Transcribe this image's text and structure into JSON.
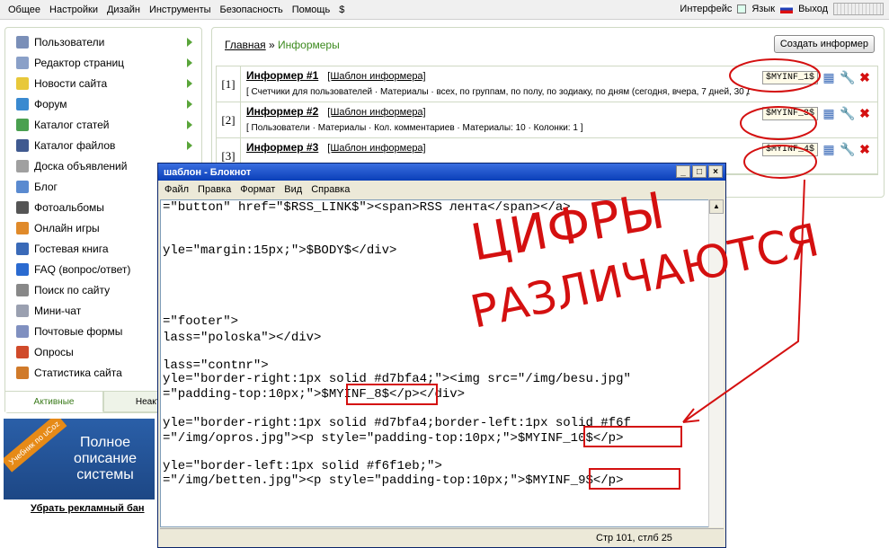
{
  "topbar": {
    "menu": [
      "Общее",
      "Настройки",
      "Дизайн",
      "Инструменты",
      "Безопасность",
      "Помощь",
      "$"
    ],
    "interface_label": "Интерфейс",
    "language_label": "Язык",
    "logout_label": "Выход"
  },
  "sidebar": {
    "items": [
      {
        "label": "Пользователи",
        "icon": "users-icon",
        "color": "#7a8fb8",
        "arrow": true
      },
      {
        "label": "Редактор страниц",
        "icon": "page-editor-icon",
        "color": "#8aa0c8",
        "arrow": true
      },
      {
        "label": "Новости сайта",
        "icon": "bulb-icon",
        "color": "#e8c83a",
        "arrow": true
      },
      {
        "label": "Форум",
        "icon": "forum-icon",
        "color": "#3a8ad0",
        "arrow": true
      },
      {
        "label": "Каталог статей",
        "icon": "articles-icon",
        "color": "#4aa050",
        "arrow": true
      },
      {
        "label": "Каталог файлов",
        "icon": "files-icon",
        "color": "#405a90",
        "arrow": true
      },
      {
        "label": "Доска объявлений",
        "icon": "board-icon",
        "color": "#a0a0a0",
        "arrow": false
      },
      {
        "label": "Блог",
        "icon": "blog-icon",
        "color": "#5a8ad0",
        "arrow": false
      },
      {
        "label": "Фотоальбомы",
        "icon": "camera-icon",
        "color": "#555555",
        "arrow": false
      },
      {
        "label": "Онлайн игры",
        "icon": "games-icon",
        "color": "#e08a2a",
        "arrow": false
      },
      {
        "label": "Гостевая книга",
        "icon": "guestbook-icon",
        "color": "#3a6ab8",
        "arrow": false
      },
      {
        "label": "FAQ (вопрос/ответ)",
        "icon": "faq-icon",
        "color": "#2a6ad0",
        "arrow": false
      },
      {
        "label": "Поиск по сайту",
        "icon": "search-icon",
        "color": "#888888",
        "arrow": false
      },
      {
        "label": "Мини-чат",
        "icon": "chat-icon",
        "color": "#9aa0b0",
        "arrow": false
      },
      {
        "label": "Почтовые формы",
        "icon": "mail-icon",
        "color": "#8090c0",
        "arrow": false
      },
      {
        "label": "Опросы",
        "icon": "poll-icon",
        "color": "#d04a2a",
        "arrow": false
      },
      {
        "label": "Статистика сайта",
        "icon": "stats-icon",
        "color": "#d07a2a",
        "arrow": false
      }
    ],
    "tab_active": "Активные",
    "tab_inactive": "Неактив"
  },
  "banner": {
    "ribbon": "Учебник по uCoz",
    "line1": "Полное",
    "line2": "описание",
    "line3": "системы",
    "ad_link": "Убрать рекламный бан"
  },
  "main": {
    "crumb_home": "Главная",
    "crumb_sep": " » ",
    "crumb_current": "Информеры",
    "create_button": "Создать информер",
    "rows": [
      {
        "num": "[1]",
        "title": "Информер #1",
        "template": "[Шаблон информера]",
        "code": "$MYINF_1$",
        "desc": "[ Счетчики для пользователей · Материалы · всех, по группам, по полу, по зодиаку, по дням (сегодня, вчера, 7 дней, 30 дней) ]"
      },
      {
        "num": "[2]",
        "title": "Информер #2",
        "template": "[Шаблон информера]",
        "code": "$MYINF_3$",
        "desc": "[ Пользователи · Материалы · Кол. комментариев · Материалы: 10 · Колонки: 1 ]"
      },
      {
        "num": "[3]",
        "title": "Информер #3",
        "template": "[Шаблон информера]",
        "code": "$MYINF_4$",
        "desc": ""
      }
    ]
  },
  "notepad": {
    "title": "шаблон - Блокнот",
    "menu": [
      "Файл",
      "Правка",
      "Формат",
      "Вид",
      "Справка"
    ],
    "lines": [
      "=\"button\" href=\"$RSS_LINK$\"><span>RSS лента</span></a>",
      "yle=\"margin:15px;\">$BODY$</div>",
      "=\"footer\">",
      "lass=\"poloska\"></div>",
      "lass=\"contnr\">",
      "yle=\"border-right:1px solid #d7bfa4;\"><img src=\"/img/besu.jpg\"",
      "=\"padding-top:10px;\">$MYINF_8$</p></div>",
      "yle=\"border-right:1px solid #d7bfa4;border-left:1px solid #f6f",
      "=\"/img/opros.jpg\"><p style=\"padding-top:10px;\">$MYINF_10$</p>",
      "yle=\"border-left:1px solid #f6f1eb;\">",
      "=\"/img/betten.jpg\"><p style=\"padding-top:10px;\">$MYINF_9$</p>"
    ],
    "status": "Стр 101, стлб 25"
  },
  "annotation": {
    "line1": "ЦИФРЫ",
    "line2": "РАЗЛИЧАЮТСЯ",
    "color": "#d41010"
  }
}
